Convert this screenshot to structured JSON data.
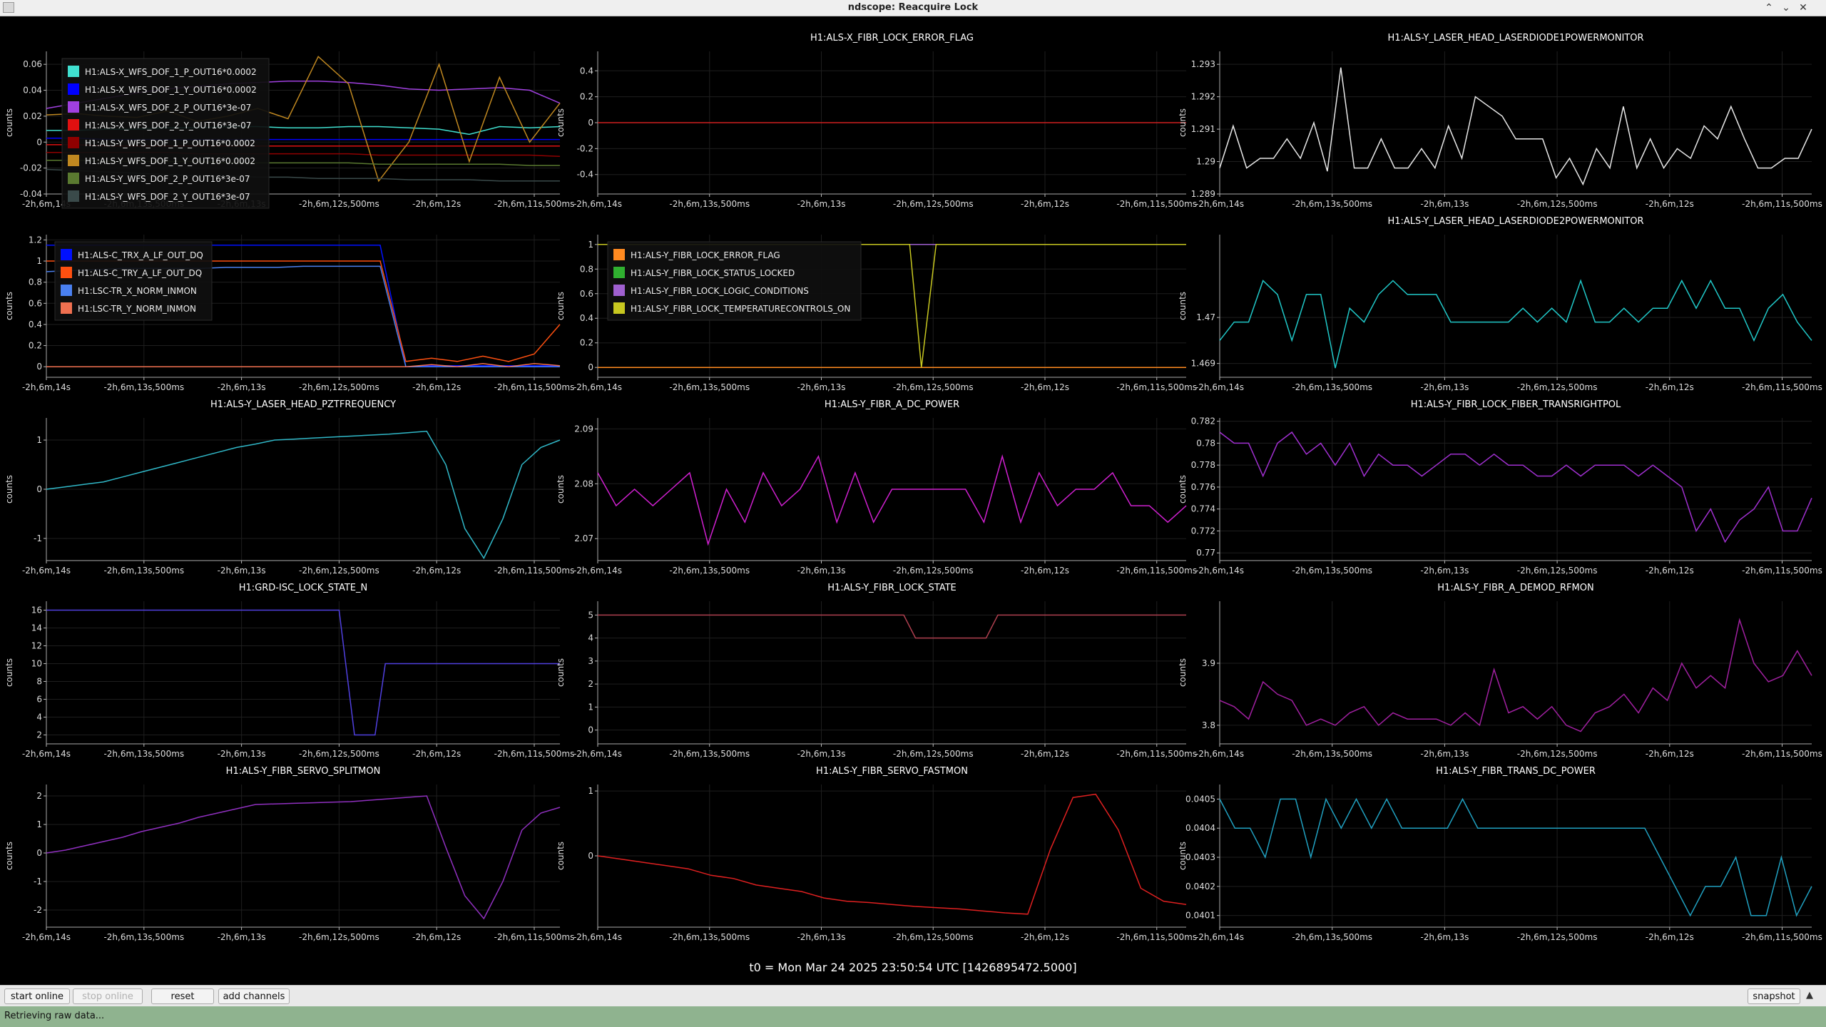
{
  "window": {
    "title": "ndscope: Reacquire Lock",
    "controls": [
      "minimize-icon",
      "maximize-icon",
      "close-icon"
    ]
  },
  "time_ticks": [
    "-2h,6m,14s",
    "-2h,6m,13s,500ms",
    "-2h,6m,13s",
    "-2h,6m,12s,500ms",
    "-2h,6m,12s",
    "-2h,6m,11s,500ms"
  ],
  "t0_label": "t0 = Mon Mar 24 2025 23:50:54 UTC [1426895472.5000]",
  "toolbar": {
    "start_online": "start online",
    "stop_online": "stop online",
    "reset": "reset",
    "add_channels": "add channels",
    "snapshot": "snapshot"
  },
  "status_text": "Retrieving raw data...",
  "chart_data": [
    {
      "type": "line",
      "title": "",
      "ylabel": "counts",
      "ylim": [
        -0.04,
        0.07
      ],
      "yticks": [
        -0.04,
        -0.02,
        0,
        0.02,
        0.04,
        0.06
      ],
      "series": [
        {
          "name": "H1:ALS-X_WFS_DOF_1_P_OUT16*0.0002",
          "color": "#40e0d0",
          "values": [
            0.009,
            0.009,
            0.01,
            0.01,
            0.011,
            0.011,
            0.012,
            0.012,
            0.011,
            0.011,
            0.012,
            0.012,
            0.011,
            0.01,
            0.006,
            0.012,
            0.011,
            0.012
          ]
        },
        {
          "name": "H1:ALS-X_WFS_DOF_1_Y_OUT16*0.0002",
          "color": "#0000ff",
          "values": [
            0.003,
            0.003,
            0.002,
            0.002,
            0.002,
            0.002,
            0.002,
            0.002,
            0.002,
            0.002,
            0.002,
            0.002,
            0.002,
            0.002,
            0.002,
            0.002,
            0.002,
            0.002
          ]
        },
        {
          "name": "H1:ALS-X_WFS_DOF_2_P_OUT16*3e-07",
          "color": "#a040e0",
          "values": [
            0.026,
            0.03,
            0.034,
            0.038,
            0.041,
            0.043,
            0.045,
            0.046,
            0.047,
            0.047,
            0.046,
            0.044,
            0.041,
            0.04,
            0.041,
            0.042,
            0.04,
            0.03
          ]
        },
        {
          "name": "H1:ALS-X_WFS_DOF_2_Y_OUT16*3e-07",
          "color": "#e01010",
          "values": [
            -0.002,
            -0.002,
            -0.003,
            -0.003,
            -0.003,
            -0.003,
            -0.003,
            -0.003,
            -0.003,
            -0.003,
            -0.003,
            -0.003,
            -0.003,
            -0.003,
            -0.003,
            -0.003,
            -0.003,
            -0.003
          ]
        },
        {
          "name": "H1:ALS-Y_WFS_DOF_1_P_OUT16*0.0002",
          "color": "#900000",
          "values": [
            -0.008,
            -0.008,
            -0.008,
            -0.008,
            -0.008,
            -0.009,
            -0.009,
            -0.009,
            -0.009,
            -0.009,
            -0.009,
            -0.01,
            -0.01,
            -0.01,
            -0.01,
            -0.01,
            -0.01,
            -0.011
          ]
        },
        {
          "name": "H1:ALS-Y_WFS_DOF_1_Y_OUT16*0.0002",
          "color": "#c08820",
          "values": [
            0.021,
            0.022,
            0.02,
            0.019,
            0.024,
            0.016,
            0.02,
            0.026,
            0.018,
            0.066,
            0.045,
            -0.03,
            0.0,
            0.06,
            -0.015,
            0.05,
            0.0,
            0.03
          ]
        },
        {
          "name": "H1:ALS-Y_WFS_DOF_2_P_OUT16*3e-07",
          "color": "#5a7a30",
          "values": [
            -0.014,
            -0.014,
            -0.015,
            -0.015,
            -0.015,
            -0.015,
            -0.016,
            -0.016,
            -0.016,
            -0.016,
            -0.016,
            -0.017,
            -0.017,
            -0.017,
            -0.017,
            -0.017,
            -0.018,
            -0.018
          ]
        },
        {
          "name": "H1:ALS-Y_WFS_DOF_2_Y_OUT16*3e-07",
          "color": "#3a4a4a",
          "values": [
            -0.021,
            -0.022,
            -0.023,
            -0.024,
            -0.025,
            -0.026,
            -0.026,
            -0.027,
            -0.027,
            -0.028,
            -0.028,
            -0.028,
            -0.029,
            -0.029,
            -0.029,
            -0.03,
            -0.03,
            -0.03
          ]
        }
      ]
    },
    {
      "type": "line",
      "title": "H1:ALS-X_FIBR_LOCK_ERROR_FLAG",
      "ylabel": "counts",
      "ylim": [
        -0.55,
        0.55
      ],
      "yticks": [
        -0.4,
        -0.2,
        0,
        0.2,
        0.4
      ],
      "series": [
        {
          "color": "#d02020",
          "values": [
            0,
            0,
            0,
            0,
            0,
            0,
            0,
            0,
            0,
            0
          ]
        }
      ]
    },
    {
      "type": "line",
      "title": "H1:ALS-Y_LASER_HEAD_LASERDIODE1POWERMONITOR",
      "ylabel": "counts",
      "ylim": [
        1.289,
        1.2934
      ],
      "yticks": [
        1.289,
        1.29,
        1.291,
        1.292,
        1.293
      ],
      "series": [
        {
          "color": "#e8e8e8",
          "values": [
            1.2898,
            1.2911,
            1.2898,
            1.2901,
            1.2901,
            1.2907,
            1.2901,
            1.2912,
            1.2897,
            1.2929,
            1.2898,
            1.2898,
            1.2907,
            1.2898,
            1.2898,
            1.2904,
            1.2898,
            1.2911,
            1.2901,
            1.292,
            1.2917,
            1.2914,
            1.2907,
            1.2907,
            1.2907,
            1.2895,
            1.2901,
            1.2893,
            1.2904,
            1.2898,
            1.2917,
            1.2898,
            1.2907,
            1.2898,
            1.2904,
            1.2901,
            1.2911,
            1.2907,
            1.2917,
            1.2907,
            1.2898,
            1.2898,
            1.2901,
            1.2901,
            1.291
          ]
        }
      ]
    },
    {
      "type": "line",
      "title": "",
      "ylabel": "counts",
      "ylim": [
        -0.1,
        1.25
      ],
      "yticks": [
        0,
        0.2,
        0.4,
        0.6,
        0.8,
        1,
        1.2
      ],
      "series": [
        {
          "name": "H1:ALS-C_TRX_A_LF_OUT_DQ",
          "color": "#0010ff",
          "values": [
            1.15,
            1.15,
            1.15,
            1.15,
            1.15,
            1.15,
            1.15,
            1.15,
            1.15,
            1.15,
            1.15,
            1.15,
            1.15,
            1.15,
            0.0,
            0.01,
            0.01,
            0.01,
            0.01,
            0.01,
            0.01
          ]
        },
        {
          "name": "H1:ALS-C_TRY_A_LF_OUT_DQ",
          "color": "#ff5010",
          "values": [
            1.0,
            1.0,
            1.0,
            1.0,
            1.0,
            1.0,
            1.0,
            1.0,
            1.0,
            1.0,
            1.0,
            1.0,
            1.0,
            1.0,
            0.05,
            0.08,
            0.05,
            0.1,
            0.05,
            0.12,
            0.4
          ]
        },
        {
          "name": "H1:LSC-TR_X_NORM_INMON",
          "color": "#4a80f0",
          "values": [
            0.9,
            0.91,
            0.92,
            0.93,
            0.93,
            0.93,
            0.93,
            0.94,
            0.94,
            0.94,
            0.95,
            0.95,
            0.95,
            0.95,
            0.0,
            0.0,
            0.0,
            0.0,
            0.0,
            0.0,
            0.0
          ]
        },
        {
          "name": "H1:LSC-TR_Y_NORM_INMON",
          "color": "#f07050",
          "values": [
            0.0,
            0.0,
            0.0,
            0.0,
            0.0,
            0.0,
            0.0,
            0.0,
            0.0,
            0.0,
            0.0,
            0.0,
            0.0,
            0.0,
            0.0,
            0.02,
            0.0,
            0.03,
            0.0,
            0.03,
            0.01
          ]
        }
      ]
    },
    {
      "type": "line",
      "title": "",
      "ylabel": "counts",
      "ylim": [
        -0.08,
        1.08
      ],
      "yticks": [
        0,
        0.2,
        0.4,
        0.6,
        0.8,
        1
      ],
      "series": [
        {
          "name": "H1:ALS-Y_FIBR_LOCK_ERROR_FLAG",
          "color": "#ff8a20",
          "values": [
            0,
            0,
            0,
            0,
            0,
            0,
            0,
            0,
            0,
            0
          ]
        },
        {
          "name": "H1:ALS-Y_FIBR_LOCK_STATUS_LOCKED",
          "color": "#30b030",
          "values": [
            1,
            1,
            1,
            1,
            1,
            1,
            1,
            1,
            1,
            1
          ]
        },
        {
          "name": "H1:ALS-Y_FIBR_LOCK_LOGIC_CONDITIONS",
          "color": "#a060d0",
          "values": [
            1,
            1,
            1,
            1,
            1,
            1,
            1,
            1,
            1,
            1
          ]
        },
        {
          "name": "H1:ALS-Y_FIBR_LOCK_TEMPERATURECONTROLS_ON",
          "color": "#c8c820",
          "x": [
            0,
            0.5,
            0.53,
            0.55,
            0.575,
            1
          ],
          "values": [
            1,
            1,
            1,
            0,
            1,
            1
          ]
        }
      ]
    },
    {
      "type": "line",
      "title": "H1:ALS-Y_LASER_HEAD_LASERDIODE2POWERMONITOR",
      "ylabel": "counts",
      "ylim": [
        1.4687,
        1.4718
      ],
      "yticks": [
        1.469,
        1.47
      ],
      "series": [
        {
          "color": "#20c8c8",
          "values": [
            1.4695,
            1.4699,
            1.4699,
            1.4708,
            1.4705,
            1.4695,
            1.4705,
            1.4705,
            1.4689,
            1.4702,
            1.4699,
            1.4705,
            1.4708,
            1.4705,
            1.4705,
            1.4705,
            1.4699,
            1.4699,
            1.4699,
            1.4699,
            1.4699,
            1.4702,
            1.4699,
            1.4702,
            1.4699,
            1.4708,
            1.4699,
            1.4699,
            1.4702,
            1.4699,
            1.4702,
            1.4702,
            1.4708,
            1.4702,
            1.4708,
            1.4702,
            1.4702,
            1.4695,
            1.4702,
            1.4705,
            1.4699,
            1.4695
          ]
        }
      ]
    },
    {
      "type": "line",
      "title": "H1:ALS-Y_LASER_HEAD_PZTFREQUENCY",
      "ylabel": "counts",
      "ylim": [
        -1.45,
        1.45
      ],
      "yticks": [
        -1,
        0,
        1
      ],
      "series": [
        {
          "color": "#30b8c8",
          "values": [
            0.0,
            0.05,
            0.1,
            0.15,
            0.25,
            0.35,
            0.45,
            0.55,
            0.65,
            0.75,
            0.85,
            0.92,
            1.0,
            1.02,
            1.04,
            1.06,
            1.08,
            1.1,
            1.12,
            1.15,
            1.18,
            0.5,
            -0.8,
            -1.4,
            -0.6,
            0.5,
            0.85,
            1.0
          ]
        }
      ]
    },
    {
      "type": "line",
      "title": "H1:ALS-Y_FIBR_A_DC_POWER",
      "ylabel": "counts",
      "ylim": [
        2.066,
        2.092
      ],
      "yticks": [
        2.07,
        2.08,
        2.09
      ],
      "series": [
        {
          "color": "#d020d0",
          "values": [
            2.082,
            2.076,
            2.079,
            2.076,
            2.079,
            2.082,
            2.069,
            2.079,
            2.073,
            2.082,
            2.076,
            2.079,
            2.085,
            2.073,
            2.082,
            2.073,
            2.079,
            2.079,
            2.079,
            2.079,
            2.079,
            2.073,
            2.085,
            2.073,
            2.082,
            2.076,
            2.079,
            2.079,
            2.082,
            2.076,
            2.076,
            2.073,
            2.076
          ]
        }
      ]
    },
    {
      "type": "line",
      "title": "H1:ALS-Y_FIBR_LOCK_FIBER_TRANSRIGHTPOL",
      "ylabel": "counts",
      "ylim": [
        0.7693,
        0.7823
      ],
      "yticks": [
        0.77,
        0.772,
        0.774,
        0.776,
        0.778,
        0.78,
        0.782
      ],
      "series": [
        {
          "color": "#a030d0",
          "values": [
            0.781,
            0.78,
            0.78,
            0.777,
            0.78,
            0.781,
            0.779,
            0.78,
            0.778,
            0.78,
            0.777,
            0.779,
            0.778,
            0.778,
            0.777,
            0.778,
            0.779,
            0.779,
            0.778,
            0.779,
            0.778,
            0.778,
            0.777,
            0.777,
            0.778,
            0.777,
            0.778,
            0.778,
            0.778,
            0.777,
            0.778,
            0.777,
            0.776,
            0.772,
            0.774,
            0.771,
            0.773,
            0.774,
            0.776,
            0.772,
            0.772,
            0.775
          ]
        }
      ]
    },
    {
      "type": "line",
      "title": "H1:GRD-ISC_LOCK_STATE_N",
      "ylabel": "counts",
      "ylim": [
        1,
        17
      ],
      "yticks": [
        2,
        4,
        6,
        8,
        10,
        12,
        14,
        16
      ],
      "series": [
        {
          "color": "#5040e0",
          "x": [
            0,
            0.57,
            0.6,
            0.64,
            0.66,
            1
          ],
          "values": [
            16,
            16,
            2,
            2,
            10,
            10
          ]
        }
      ]
    },
    {
      "type": "line",
      "title": "H1:ALS-Y_FIBR_LOCK_STATE",
      "ylabel": "counts",
      "ylim": [
        -0.6,
        5.6
      ],
      "yticks": [
        0,
        1,
        2,
        3,
        4,
        5
      ],
      "series": [
        {
          "color": "#b04050",
          "x": [
            0,
            0.52,
            0.54,
            0.66,
            0.68,
            1
          ],
          "values": [
            5,
            5,
            4,
            4,
            5,
            5
          ]
        }
      ]
    },
    {
      "type": "line",
      "title": "H1:ALS-Y_FIBR_A_DEMOD_RFMON",
      "ylabel": "counts",
      "ylim": [
        3.77,
        4.0
      ],
      "yticks": [
        3.8,
        3.9
      ],
      "series": [
        {
          "color": "#a020a0",
          "values": [
            3.84,
            3.83,
            3.81,
            3.87,
            3.85,
            3.84,
            3.8,
            3.81,
            3.8,
            3.82,
            3.83,
            3.8,
            3.82,
            3.81,
            3.81,
            3.81,
            3.8,
            3.82,
            3.8,
            3.89,
            3.82,
            3.83,
            3.81,
            3.83,
            3.8,
            3.79,
            3.82,
            3.83,
            3.85,
            3.82,
            3.86,
            3.84,
            3.9,
            3.86,
            3.88,
            3.86,
            3.97,
            3.9,
            3.87,
            3.88,
            3.92,
            3.88
          ]
        }
      ]
    },
    {
      "type": "line",
      "title": "H1:ALS-Y_FIBR_SERVO_SPLITMON",
      "ylabel": "counts",
      "ylim": [
        -2.6,
        2.4
      ],
      "yticks": [
        -2,
        -1,
        0,
        1,
        2
      ],
      "series": [
        {
          "color": "#9030c0",
          "values": [
            0.0,
            0.1,
            0.25,
            0.4,
            0.55,
            0.75,
            0.9,
            1.05,
            1.25,
            1.4,
            1.55,
            1.7,
            1.72,
            1.74,
            1.76,
            1.78,
            1.8,
            1.85,
            1.9,
            1.95,
            2.0,
            0.2,
            -1.5,
            -2.3,
            -1.0,
            0.8,
            1.4,
            1.6
          ]
        }
      ]
    },
    {
      "type": "line",
      "title": "H1:ALS-Y_FIBR_SERVO_FASTMON",
      "ylabel": "counts",
      "ylim": [
        -1.1,
        1.1
      ],
      "yticks": [
        0,
        1
      ],
      "series": [
        {
          "color": "#e02020",
          "values": [
            0.0,
            -0.05,
            -0.1,
            -0.15,
            -0.2,
            -0.3,
            -0.35,
            -0.45,
            -0.5,
            -0.55,
            -0.65,
            -0.7,
            -0.72,
            -0.75,
            -0.78,
            -0.8,
            -0.82,
            -0.85,
            -0.88,
            -0.9,
            0.1,
            0.9,
            0.95,
            0.4,
            -0.5,
            -0.7,
            -0.75
          ]
        }
      ]
    },
    {
      "type": "line",
      "title": "H1:ALS-Y_FIBR_TRANS_DC_POWER",
      "ylabel": "counts",
      "ylim": [
        0.04006,
        0.04055
      ],
      "yticks": [
        0.0401,
        0.0402,
        0.0403,
        0.0404,
        0.0405
      ],
      "series": [
        {
          "color": "#20a0c0",
          "values": [
            0.0405,
            0.0404,
            0.0404,
            0.0403,
            0.0405,
            0.0405,
            0.0403,
            0.0405,
            0.0404,
            0.0405,
            0.0404,
            0.0405,
            0.0404,
            0.0404,
            0.0404,
            0.0404,
            0.0405,
            0.0404,
            0.0404,
            0.0404,
            0.0404,
            0.0404,
            0.0404,
            0.0404,
            0.0404,
            0.0404,
            0.0404,
            0.0404,
            0.0404,
            0.0403,
            0.0402,
            0.0401,
            0.0402,
            0.0402,
            0.0403,
            0.0401,
            0.0401,
            0.0403,
            0.0401,
            0.0402
          ]
        }
      ]
    }
  ]
}
